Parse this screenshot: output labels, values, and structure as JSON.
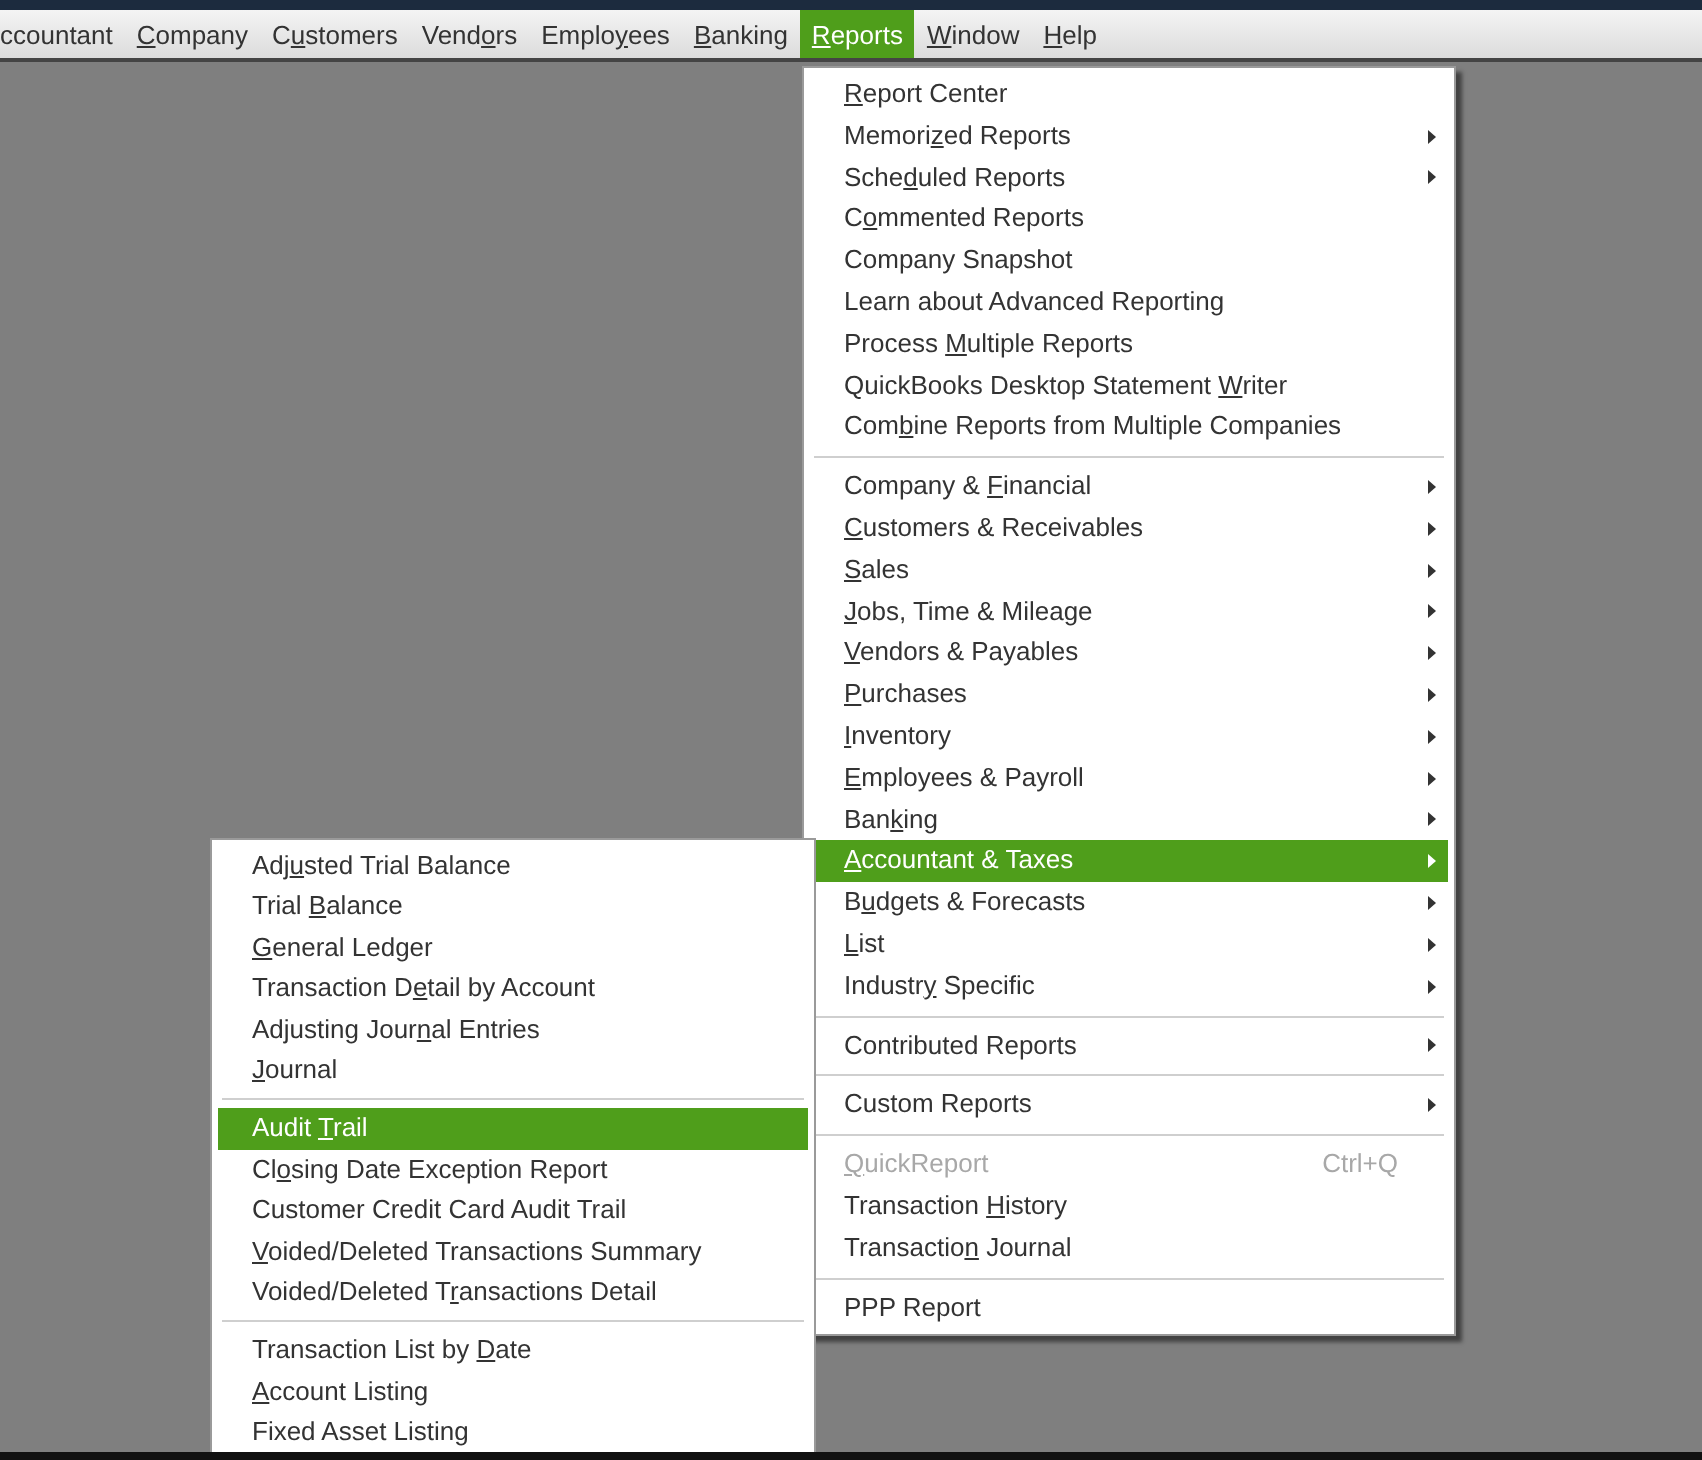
{
  "menubar": [
    {
      "label": [
        {
          "t": "ccountant"
        }
      ],
      "selected": false
    },
    {
      "label": [
        {
          "t": "C",
          "u": true
        },
        {
          "t": "ompany"
        }
      ],
      "selected": false
    },
    {
      "label": [
        {
          "t": "C"
        },
        {
          "t": "u",
          "u": true
        },
        {
          "t": "stomers"
        }
      ],
      "selected": false
    },
    {
      "label": [
        {
          "t": "Vend"
        },
        {
          "t": "o",
          "u": true
        },
        {
          "t": "rs"
        }
      ],
      "selected": false
    },
    {
      "label": [
        {
          "t": "Emplo"
        },
        {
          "t": "y",
          "u": true
        },
        {
          "t": "ees"
        }
      ],
      "selected": false
    },
    {
      "label": [
        {
          "t": "B",
          "u": true
        },
        {
          "t": "anking"
        }
      ],
      "selected": false
    },
    {
      "label": [
        {
          "t": "R",
          "u": true
        },
        {
          "t": "eports"
        }
      ],
      "selected": true
    },
    {
      "label": [
        {
          "t": "W",
          "u": true
        },
        {
          "t": "indow"
        }
      ],
      "selected": false
    },
    {
      "label": [
        {
          "t": "H",
          "u": true
        },
        {
          "t": "elp"
        }
      ],
      "selected": false
    }
  ],
  "reports_menu": [
    [
      {
        "label": [
          {
            "t": "R",
            "u": true
          },
          {
            "t": "eport Center"
          }
        ]
      },
      {
        "label": [
          {
            "t": "Memori"
          },
          {
            "t": "z",
            "u": true
          },
          {
            "t": "ed Reports"
          }
        ],
        "submenu": true
      },
      {
        "label": [
          {
            "t": "Sche"
          },
          {
            "t": "d",
            "u": true
          },
          {
            "t": "uled Reports"
          }
        ],
        "submenu": true
      },
      {
        "label": [
          {
            "t": "C"
          },
          {
            "t": "o",
            "u": true
          },
          {
            "t": "mmented Reports"
          }
        ]
      },
      {
        "label": [
          {
            "t": "Company Snapshot"
          }
        ]
      },
      {
        "label": [
          {
            "t": "Learn about  Advanced Reporting"
          }
        ]
      },
      {
        "label": [
          {
            "t": "Process "
          },
          {
            "t": "M",
            "u": true
          },
          {
            "t": "ultiple Reports"
          }
        ]
      },
      {
        "label": [
          {
            "t": "QuickBooks Desktop Statement "
          },
          {
            "t": "W",
            "u": true
          },
          {
            "t": "riter"
          }
        ]
      },
      {
        "label": [
          {
            "t": "Com"
          },
          {
            "t": "b",
            "u": true
          },
          {
            "t": "ine Reports from Multiple Companies"
          }
        ]
      }
    ],
    [
      {
        "label": [
          {
            "t": "Company & "
          },
          {
            "t": "F",
            "u": true
          },
          {
            "t": "inancial"
          }
        ],
        "submenu": true
      },
      {
        "label": [
          {
            "t": "C",
            "u": true
          },
          {
            "t": "ustomers & Receivables"
          }
        ],
        "submenu": true
      },
      {
        "label": [
          {
            "t": "S",
            "u": true
          },
          {
            "t": "ales"
          }
        ],
        "submenu": true
      },
      {
        "label": [
          {
            "t": "J",
            "u": true
          },
          {
            "t": "obs, Time & Mileage"
          }
        ],
        "submenu": true
      },
      {
        "label": [
          {
            "t": "V",
            "u": true
          },
          {
            "t": "endors & Payables"
          }
        ],
        "submenu": true
      },
      {
        "label": [
          {
            "t": "P",
            "u": true
          },
          {
            "t": "urchases"
          }
        ],
        "submenu": true
      },
      {
        "label": [
          {
            "t": "I",
            "u": true
          },
          {
            "t": "nventory"
          }
        ],
        "submenu": true
      },
      {
        "label": [
          {
            "t": "E",
            "u": true
          },
          {
            "t": "mployees & Payroll"
          }
        ],
        "submenu": true
      },
      {
        "label": [
          {
            "t": "Ban"
          },
          {
            "t": "k",
            "u": true
          },
          {
            "t": "ing"
          }
        ],
        "submenu": true
      },
      {
        "label": [
          {
            "t": "A",
            "u": true
          },
          {
            "t": "ccountant & Taxes"
          }
        ],
        "submenu": true,
        "selected": true
      },
      {
        "label": [
          {
            "t": "B"
          },
          {
            "t": "u",
            "u": true
          },
          {
            "t": "dgets & Forecasts"
          }
        ],
        "submenu": true
      },
      {
        "label": [
          {
            "t": "L",
            "u": true
          },
          {
            "t": "ist"
          }
        ],
        "submenu": true
      },
      {
        "label": [
          {
            "t": "Industr"
          },
          {
            "t": "y",
            "u": true
          },
          {
            "t": " Specific"
          }
        ],
        "submenu": true
      }
    ],
    [
      {
        "label": [
          {
            "t": "Contributed Reports"
          }
        ],
        "submenu": true
      }
    ],
    [
      {
        "label": [
          {
            "t": "Custom Reports"
          }
        ],
        "submenu": true
      }
    ],
    [
      {
        "label": [
          {
            "t": "Q",
            "u": true
          },
          {
            "t": "uickReport"
          }
        ],
        "disabled": true,
        "shortcut": "Ctrl+Q"
      },
      {
        "label": [
          {
            "t": "Transaction "
          },
          {
            "t": "H",
            "u": true
          },
          {
            "t": "istory"
          }
        ]
      },
      {
        "label": [
          {
            "t": "Transactio"
          },
          {
            "t": "n",
            "u": true
          },
          {
            "t": " Journal"
          }
        ]
      }
    ],
    [
      {
        "label": [
          {
            "t": "PPP Report"
          }
        ]
      }
    ]
  ],
  "accountant_submenu": [
    [
      {
        "label": [
          {
            "t": "Adj"
          },
          {
            "t": "u",
            "u": true
          },
          {
            "t": "sted Trial Balance"
          }
        ]
      },
      {
        "label": [
          {
            "t": "Trial "
          },
          {
            "t": "B",
            "u": true
          },
          {
            "t": "alance"
          }
        ]
      },
      {
        "label": [
          {
            "t": "G",
            "u": true
          },
          {
            "t": "eneral Ledger"
          }
        ]
      },
      {
        "label": [
          {
            "t": "Transaction D"
          },
          {
            "t": "e",
            "u": true
          },
          {
            "t": "tail by Account"
          }
        ]
      },
      {
        "label": [
          {
            "t": "Adjusting Jour"
          },
          {
            "t": "n",
            "u": true
          },
          {
            "t": "al Entries"
          }
        ]
      },
      {
        "label": [
          {
            "t": "J",
            "u": true
          },
          {
            "t": "ournal"
          }
        ]
      }
    ],
    [
      {
        "label": [
          {
            "t": "Audit "
          },
          {
            "t": "T",
            "u": true
          },
          {
            "t": "rail"
          }
        ],
        "selected": true
      },
      {
        "label": [
          {
            "t": "Cl"
          },
          {
            "t": "o",
            "u": true
          },
          {
            "t": "sing Date Exception Report"
          }
        ]
      },
      {
        "label": [
          {
            "t": "Customer Credit Card Audit Trail"
          }
        ]
      },
      {
        "label": [
          {
            "t": "V",
            "u": true
          },
          {
            "t": "oided/Deleted Transactions Summary"
          }
        ]
      },
      {
        "label": [
          {
            "t": "Voided/Deleted T"
          },
          {
            "t": "r",
            "u": true
          },
          {
            "t": "ansactions Detail"
          }
        ]
      }
    ],
    [
      {
        "label": [
          {
            "t": "Transaction List by "
          },
          {
            "t": "D",
            "u": true
          },
          {
            "t": "ate"
          }
        ]
      },
      {
        "label": [
          {
            "t": "A",
            "u": true
          },
          {
            "t": "ccount Listing"
          }
        ]
      },
      {
        "label": [
          {
            "t": "Fixed Asset Listing"
          }
        ]
      }
    ]
  ]
}
